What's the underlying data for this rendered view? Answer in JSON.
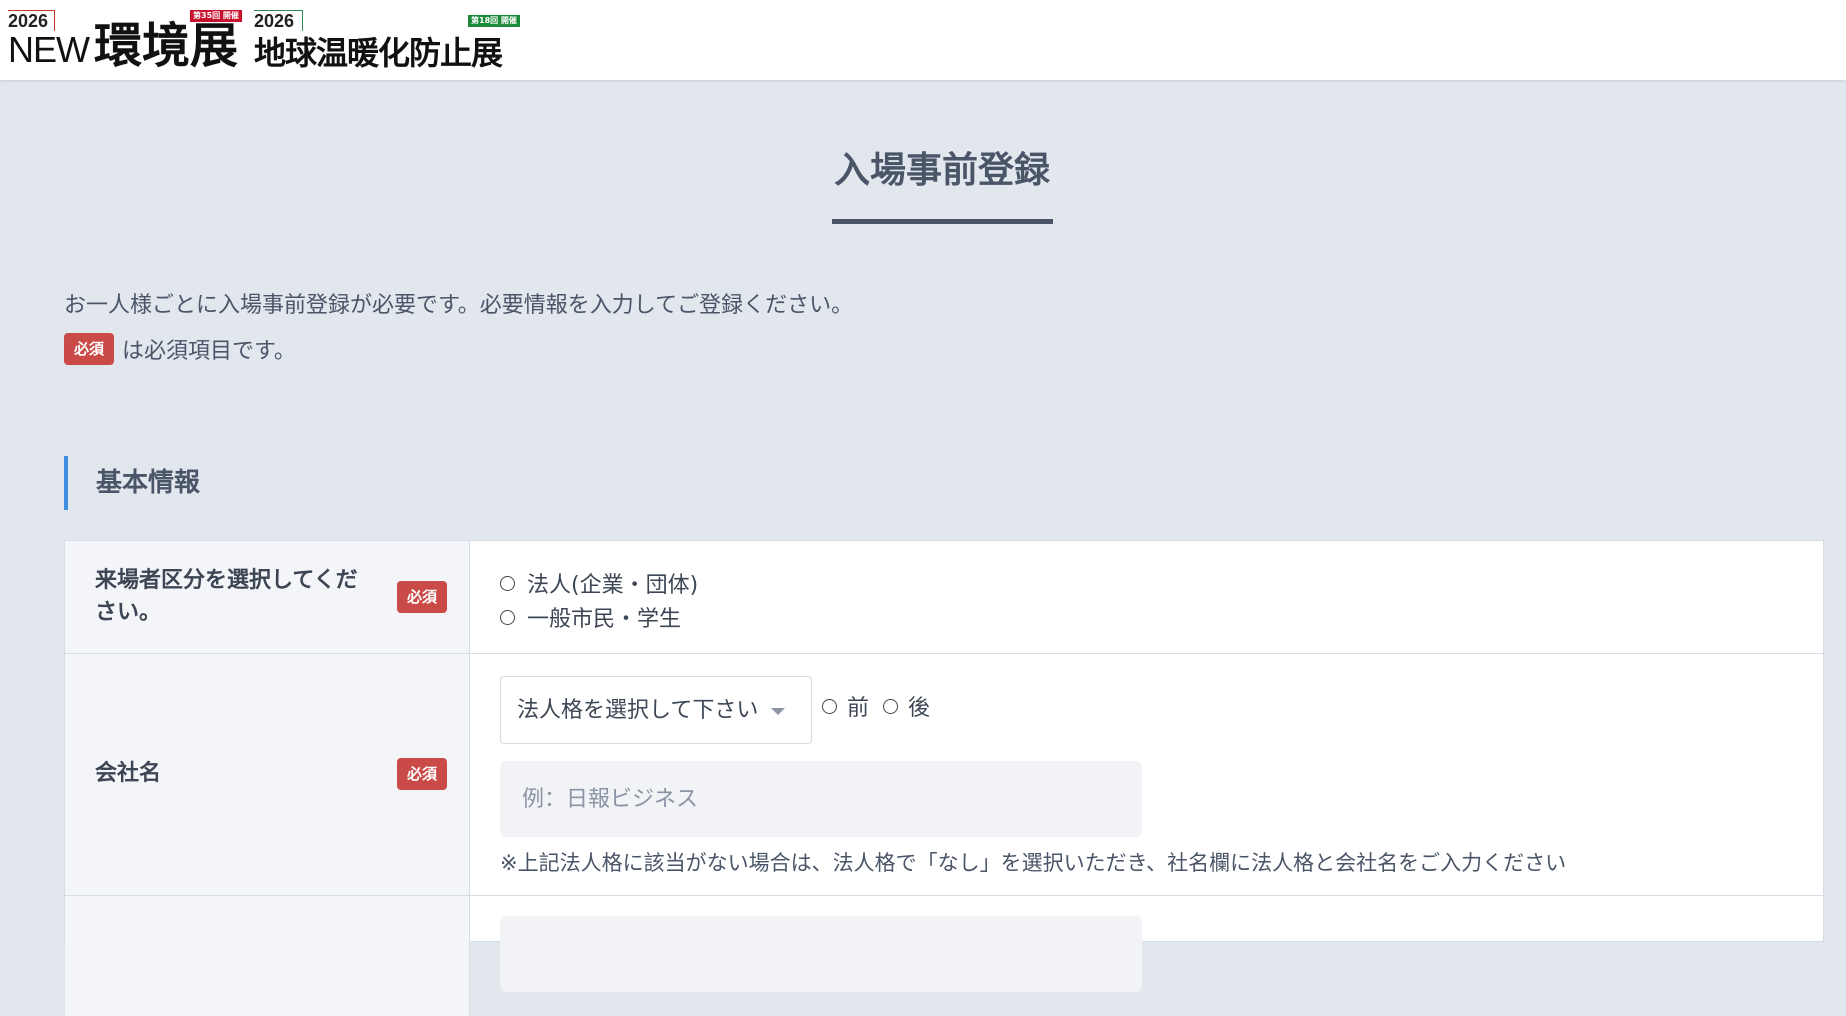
{
  "header": {
    "logo_new": {
      "year": "2026",
      "badge": "第35回 開催",
      "new_text": "NEW",
      "kanji": "環境展"
    },
    "logo_global_warming": {
      "year": "2026",
      "badge": "第18回 開催",
      "kanji": "地球温暖化防止展"
    }
  },
  "page": {
    "title": "入場事前登録",
    "intro": "お一人様ごとに入場事前登録が必要です。必要情報を入力してご登録ください。",
    "required_badge": "必須",
    "required_note": "は必須項目です。"
  },
  "section": {
    "title": "基本情報"
  },
  "form": {
    "visitor_type": {
      "label": "来場者区分を選択してください。",
      "required": "必須",
      "options": [
        "法人(企業・団体)",
        "一般市民・学生"
      ]
    },
    "company": {
      "label": "会社名",
      "required": "必須",
      "select_value": "法人格を選択して下さい",
      "position_options": [
        "前",
        "後"
      ],
      "placeholder": "例：日報ビジネス",
      "note": "※上記法人格に該当がない場合は、法人格で「なし」を選択いただき、社名欄に法人格と会社名をご入力ください"
    }
  },
  "colors": {
    "background": "#e2e7ee",
    "required_badge": "#c94a46",
    "section_accent": "#3f8ee0",
    "title_text": "#4a5568"
  }
}
